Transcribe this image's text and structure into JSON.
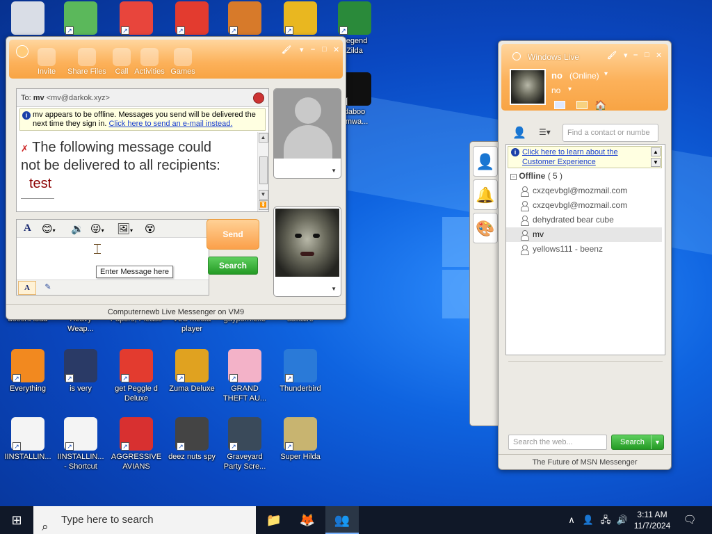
{
  "desktop": {
    "icons": [
      {
        "label": "",
        "icon": "recycle-bin-icon",
        "color": "#d9dde6"
      },
      {
        "label": "",
        "icon": "messenger-icon",
        "color": "#5bb85b"
      },
      {
        "label": "",
        "icon": "chrome-icon",
        "color": "#e8453c"
      },
      {
        "label": "",
        "icon": "peggle-icon",
        "color": "#e33b2f"
      },
      {
        "label": "",
        "icon": "papers-icon",
        "color": "#d77a2a"
      },
      {
        "label": "",
        "icon": "shield-icon",
        "color": "#e9b720"
      },
      {
        "label": "Legend\nZilda",
        "icon": "zelda-icon",
        "color": "#2a8a3a"
      },
      {
        "label": "daboo\nomwa...",
        "icon": "shma-icon",
        "color": "#101010"
      },
      {
        "label": "doesnt load",
        "icon": "",
        "color": ""
      },
      {
        "label": "Heavy\nWeap...",
        "icon": "",
        "color": ""
      },
      {
        "label": "Papers, Please",
        "icon": "",
        "color": ""
      },
      {
        "label": "VLC media\nplayer",
        "icon": "",
        "color": ""
      },
      {
        "label": "gayporn.exe",
        "icon": "",
        "color": ""
      },
      {
        "label": "solitaire",
        "icon": "",
        "color": ""
      },
      {
        "label": "Everything",
        "icon": "everything-icon",
        "color": "#f2891f"
      },
      {
        "label": "is very",
        "icon": "badge-icon",
        "color": "#2a3a66"
      },
      {
        "label": "get Peggle d\nDeluxe",
        "icon": "peggle-icon",
        "color": "#e33b2f"
      },
      {
        "label": "Zuma Deluxe",
        "icon": "zuma-icon",
        "color": "#e0a220"
      },
      {
        "label": "GRAND\nTHEFT AU...",
        "icon": "anime-girl-icon",
        "color": "#f3b2c8"
      },
      {
        "label": "Thunderbird",
        "icon": "thunderbird-icon",
        "color": "#2a7ad8"
      },
      {
        "label": "IINSTALLIN...",
        "icon": "document-icon",
        "color": "#f4f4f4"
      },
      {
        "label": "IINSTALLIN...\n- Shortcut",
        "icon": "document-icon",
        "color": "#f4f4f4"
      },
      {
        "label": "AGGRESSIVE\nAVIANS",
        "icon": "angry-bird-icon",
        "color": "#d83030"
      },
      {
        "label": "deez nuts spy",
        "icon": "windows-stack-icon",
        "color": "#444"
      },
      {
        "label": "Graveyard\nParty Scre...",
        "icon": "graveyard-icon",
        "color": "#3a4a5a"
      },
      {
        "label": "Super Hilda",
        "icon": "pixel-icon",
        "color": "#c8b470"
      }
    ]
  },
  "conversation": {
    "toolbar": [
      {
        "label": "Invite",
        "icon": "invite-icon"
      },
      {
        "label": "Share Files",
        "icon": "folder-icon"
      },
      {
        "label": "Call",
        "icon": "phone-icon"
      },
      {
        "label": "Activities",
        "icon": "activities-icon"
      },
      {
        "label": "Games",
        "icon": "games-icon"
      }
    ],
    "to_prefix": "To:",
    "to_name": "mv",
    "to_email": "<mv@darkok.xyz>",
    "info_text": "mv appears to be offline. Messages you send will be delivered the next time they sign in. ",
    "info_link": "Click here to send an e-mail instead.",
    "error_line1": "The following message could",
    "error_line2": "not be delivered to all recipients:",
    "failed_message": "test",
    "compose_tooltip": "Enter Message here",
    "send_label": "Send",
    "search_label": "Search",
    "status_bar": "Computernewb Live Messenger on VM9"
  },
  "live": {
    "title": "Windows Live",
    "user_name": "no",
    "user_status": "(Online)",
    "personal_message": "no",
    "find_placeholder": "Find a contact or numbe",
    "info_link": "Click here to learn about the Customer Experience",
    "group_label": "Offline",
    "group_count": "( 5 )",
    "contacts": [
      "cxzqevbgl@mozmail.com",
      "cxzqevbgl@mozmail.com",
      "dehydrated bear cube",
      "mv",
      "yellows111 - beenz"
    ],
    "web_search_placeholder": "Search the web...",
    "web_search_button": "Search",
    "footer": "The Future of MSN Messenger"
  },
  "taskbar": {
    "search_placeholder": "Type here to search",
    "time": "3:11 AM",
    "date": "11/7/2024"
  },
  "colors": {
    "accent_orange": "#f8a444",
    "search_green": "#249a24",
    "error_red": "#8b0000",
    "link_blue": "#1a3fd0"
  }
}
